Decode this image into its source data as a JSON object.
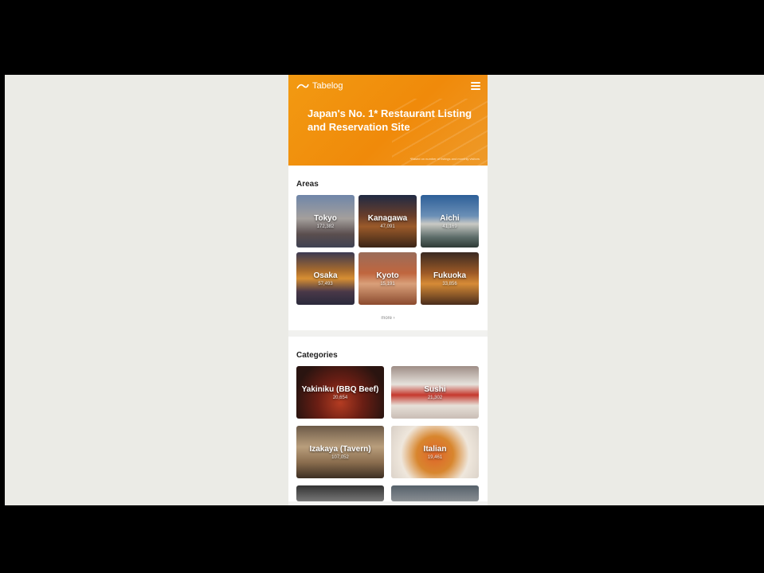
{
  "header": {
    "logo_text": "Tabelog",
    "title": "Japan's No. 1* Restaurant Listing and Reservation Site",
    "note": "*Based on number of listings and monthly visitors"
  },
  "areas": {
    "title": "Areas",
    "items": [
      {
        "name": "Tokyo",
        "count": "172,382"
      },
      {
        "name": "Kanagawa",
        "count": "47,091"
      },
      {
        "name": "Aichi",
        "count": "41,169"
      },
      {
        "name": "Osaka",
        "count": "57,493"
      },
      {
        "name": "Kyoto",
        "count": "15,191"
      },
      {
        "name": "Fukuoka",
        "count": "33,856"
      }
    ],
    "more_label": "more"
  },
  "categories": {
    "title": "Categories",
    "items": [
      {
        "name": "Yakiniku (BBQ Beef)",
        "count": "20,654"
      },
      {
        "name": "Sushi",
        "count": "21,302"
      },
      {
        "name": "Izakaya (Tavern)",
        "count": "107,052"
      },
      {
        "name": "Italian",
        "count": "19,461"
      }
    ]
  },
  "colors": {
    "brand_orange": "#f29a12",
    "letterbox": "#000000",
    "viewport_bg": "#ebebe6"
  }
}
